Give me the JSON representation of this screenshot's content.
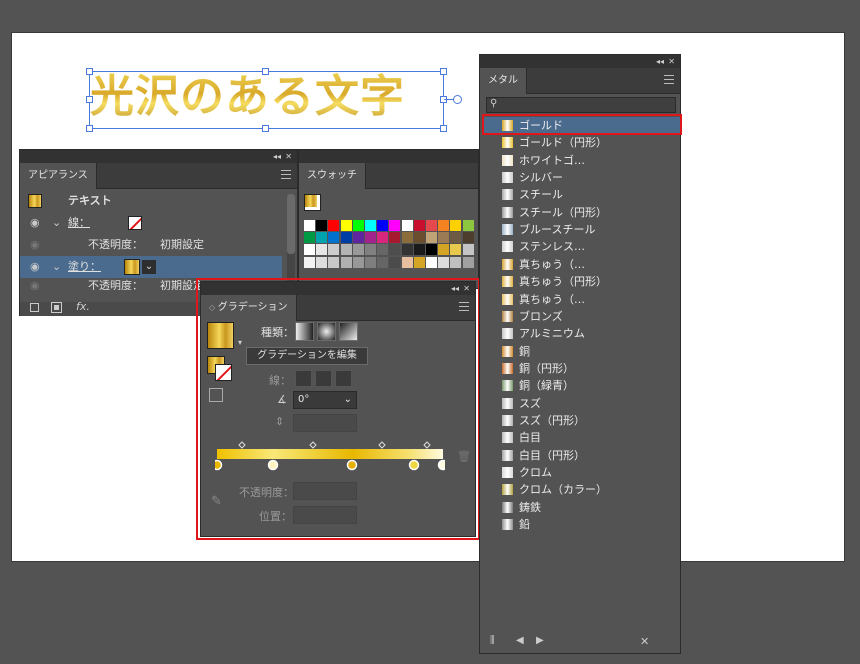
{
  "canvas": {
    "gold_text": "光沢のある文字"
  },
  "appearance": {
    "tab": "アピアランス",
    "object_label": "テキスト",
    "stroke_label": "線：",
    "opacity1_label": "不透明度：",
    "opacity1_value": "初期設定",
    "fill_label": "塗り：",
    "opacity2_label": "不透明度：",
    "opacity2_value": "初期設定",
    "fx": "fx."
  },
  "swatches": {
    "tab": "スウォッチ"
  },
  "gradient": {
    "tab": "グラデーション",
    "type_label": "種類：",
    "edit_button": "グラデーションを編集",
    "stroke_label": "線：",
    "angle_value": "0°",
    "opacity_label": "不透明度：",
    "position_label": "位置："
  },
  "metal": {
    "tab": "メタル",
    "items": [
      {
        "label": "ゴールド",
        "color": "#d4a524"
      },
      {
        "label": "ゴールド（円形）",
        "color": "#e8c030"
      },
      {
        "label": "ホワイトゴ…",
        "color": "#eee2c4"
      },
      {
        "label": "シルバー",
        "color": "#c8c8c8"
      },
      {
        "label": "スチール",
        "color": "#a8a8a8"
      },
      {
        "label": "スチール（円形）",
        "color": "#9a9a9a"
      },
      {
        "label": "ブルースチール",
        "color": "#9ab0c8"
      },
      {
        "label": "ステンレス…",
        "color": "#d0d0d0"
      },
      {
        "label": "真ちゅう（…",
        "color": "#d6a230"
      },
      {
        "label": "真ちゅう（円形）",
        "color": "#e0b040"
      },
      {
        "label": "真ちゅう（…",
        "color": "#e6c064"
      },
      {
        "label": "ブロンズ",
        "color": "#b08040"
      },
      {
        "label": "アルミニウム",
        "color": "#c4c4c4"
      },
      {
        "label": "銅",
        "color": "#d08a30"
      },
      {
        "label": "銅（円形）",
        "color": "#c86a28"
      },
      {
        "label": "銅（緑青）",
        "color": "#7a9a6a"
      },
      {
        "label": "スズ",
        "color": "#b8b8b8"
      },
      {
        "label": "スズ（円形）",
        "color": "#b0b0b0"
      },
      {
        "label": "白目",
        "color": "#bcbcbc"
      },
      {
        "label": "白目（円形）",
        "color": "#a4a4a4"
      },
      {
        "label": "クロム",
        "color": "#d8d8d8"
      },
      {
        "label": "クロム（カラー）",
        "color": "#b0a040"
      },
      {
        "label": "鋳鉄",
        "color": "#7a7a7a"
      },
      {
        "label": "鉛",
        "color": "#909090"
      }
    ]
  }
}
